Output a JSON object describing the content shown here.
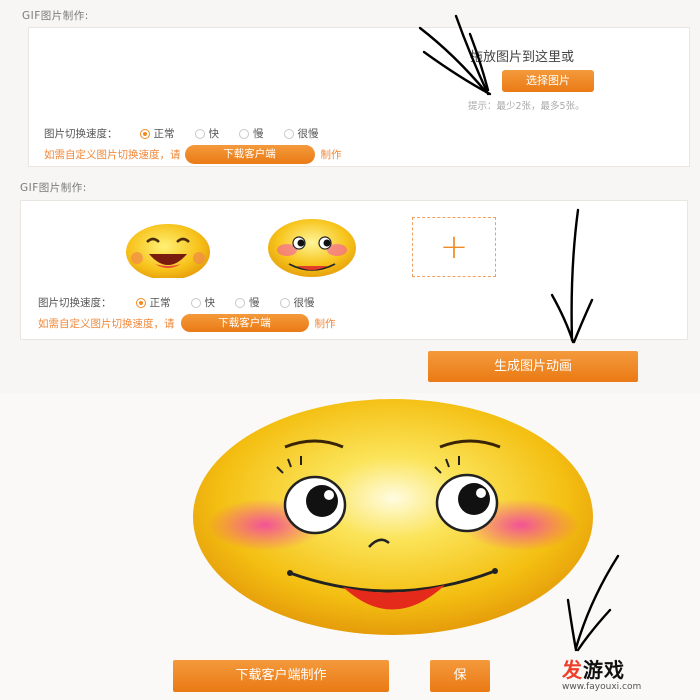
{
  "panel1": {
    "title": "GIF图片制作:",
    "drop_text": "拖放图片到这里或",
    "choose_button": "选择图片",
    "hint": "提示：最少2张，最多5张。",
    "speed_label": "图片切换速度：",
    "speed_options": [
      "正常",
      "快",
      "慢",
      "很慢"
    ],
    "speed_selected": "正常",
    "custom_prefix": "如需自定义图片切换速度，请",
    "download_button": "下载客户端",
    "custom_suffix": "制作"
  },
  "panel2": {
    "title": "GIF图片制作:",
    "add_symbol": "+",
    "speed_label": "图片切换速度：",
    "speed_options": [
      "正常",
      "快",
      "慢",
      "很慢"
    ],
    "speed_selected": "正常",
    "custom_prefix": "如需自定义图片切换速度，请",
    "download_button": "下载客户端",
    "custom_suffix": "制作",
    "generate_button": "生成图片动画"
  },
  "panel3": {
    "download_make_button": "下载客户端制作",
    "second_button": "保"
  },
  "watermark": {
    "brand_accent": "发",
    "brand_rest": "游戏",
    "url": "www.fayouxi.com"
  },
  "colors": {
    "accent": "#f08a23",
    "emoji_yellow": "#f6c61a",
    "blush": "#f35ab0"
  },
  "icons": [
    "plus-icon",
    "arrow-down-icon",
    "smiley-laugh-icon",
    "smiley-blush-icon"
  ]
}
